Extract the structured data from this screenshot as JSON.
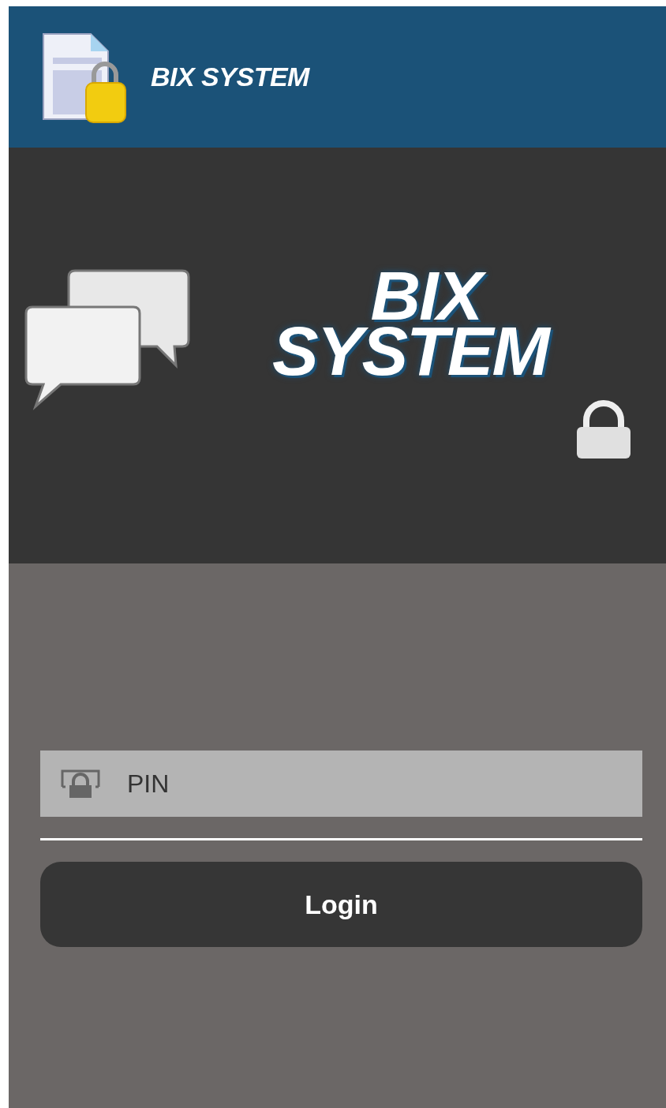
{
  "header": {
    "title": "BIX SYSTEM"
  },
  "banner": {
    "logo_lines": [
      "BIX",
      "SYSTEM"
    ]
  },
  "login": {
    "pin_field": {
      "placeholder": "PIN"
    },
    "button": "Login"
  }
}
